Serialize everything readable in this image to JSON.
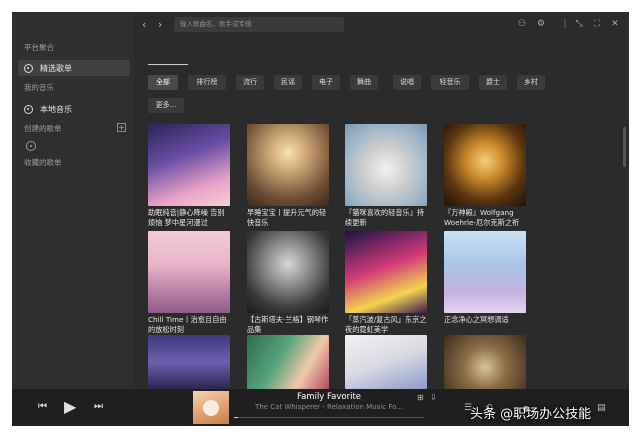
{
  "sidebar": {
    "section_platform": "平台聚合",
    "featured": "精选歌单",
    "section_my_music": "我的音乐",
    "local_music": "本地音乐",
    "created_playlists": "创建的歌单",
    "collected_playlists": "收藏的歌单"
  },
  "topbar": {
    "search_placeholder": "输入歌曲名、歌手或专辑"
  },
  "categories": [
    "全部",
    "排行榜",
    "流行",
    "民谣",
    "电子",
    "舞曲",
    "说唱",
    "轻音乐",
    "爵士",
    "乡村",
    "更多..."
  ],
  "playlists": [
    {
      "title": "助眠纯音|静心降噪 告别烦恼 梦中星河漫过"
    },
    {
      "title": "早睡宝宝丨提升元气的轻快音乐"
    },
    {
      "title": "『猫咪喜欢的轻音乐』持续更新"
    },
    {
      "title": "『万神殿』Wolfgang Woehrle-厄尔克斯之祈"
    },
    {
      "title": "Chill Time丨治愈且自由的放松时刻"
    },
    {
      "title": "【古斯塔夫·兰格】钢琴作品集"
    },
    {
      "title": "「蒸汽波/复古风」东京之夜的霓虹美学"
    },
    {
      "title": "正念净心之冥想调适"
    },
    {
      "title": ""
    },
    {
      "title": ""
    },
    {
      "title": ""
    },
    {
      "title": ""
    }
  ],
  "player": {
    "title": "Family Favorite",
    "subtitle": "The Cat Whisperer - Relaxation Music Fo...",
    "progress": 0.02
  },
  "watermark": "头条 @职场办公技能",
  "colors": {
    "background": "#2b2b2b",
    "sidebar": "#2f2f2f",
    "player": "#1f1f1f",
    "chip": "#3a3a3a"
  }
}
